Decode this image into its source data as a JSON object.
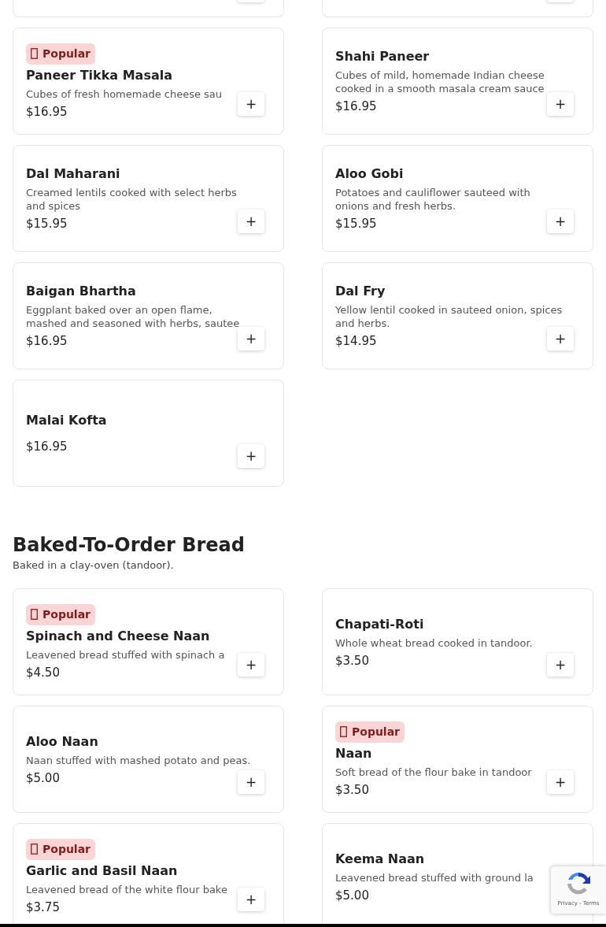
{
  "sections": [
    {
      "items": [
        {
          "badge": "Popular",
          "name": "Paneer Tikka Masala",
          "description": "Cubes of fresh homemade cheese sau",
          "price": "$16.95",
          "add": "+"
        },
        {
          "name": "Shahi Paneer",
          "description": "Cubes of mild, homemade Indian cheese cooked in a smooth masala cream sauce",
          "price": "$16.95",
          "add": "+"
        },
        {
          "name": "Dal Maharani",
          "description": "Creamed lentils cooked with select herbs and spices",
          "price": "$15.95",
          "add": "+"
        },
        {
          "name": "Aloo Gobi",
          "description": "Potatoes and cauliflower sauteed with onions and fresh herbs.",
          "price": "$15.95",
          "add": "+"
        },
        {
          "name": "Baigan Bhartha",
          "description": "Eggplant baked over an open flame, mashed and seasoned with herbs, sautee",
          "price": "$16.95",
          "add": "+"
        },
        {
          "name": "Dal Fry",
          "description": "Yellow lentil cooked in sauteed onion, spices and herbs.",
          "price": "$14.95",
          "add": "+"
        },
        {
          "name": "Malai Kofta",
          "price": "$16.95",
          "add": "+"
        }
      ]
    },
    {
      "title": "Baked-To-Order Bread",
      "subtitle": "Baked in a clay-oven (tandoor).",
      "items": [
        {
          "badge": "Popular",
          "name": "Spinach and Cheese Naan",
          "description": "Leavened bread stuffed with spinach a",
          "price": "$4.50",
          "add": "+"
        },
        {
          "name": "Chapati-Roti",
          "description": "Whole wheat bread cooked in tandoor.",
          "price": "$3.50",
          "add": "+"
        },
        {
          "name": "Aloo Naan",
          "description": "Naan stuffed with mashed potato and peas.",
          "price": "$5.00",
          "add": "+"
        },
        {
          "badge": "Popular",
          "name": "Naan",
          "description": "Soft bread of the flour bake in tandoor",
          "price": "$3.50",
          "add": "+"
        },
        {
          "badge": "Popular",
          "name": "Garlic and Basil Naan",
          "description": "Leavened bread of the white flour bake",
          "price": "$3.75",
          "add": "+"
        },
        {
          "name": "Keema Naan",
          "description": "Leavened bread stuffed with ground la",
          "price": "$5.00"
        }
      ]
    }
  ],
  "recaptcha": {
    "links": "Privacy - Terms"
  }
}
